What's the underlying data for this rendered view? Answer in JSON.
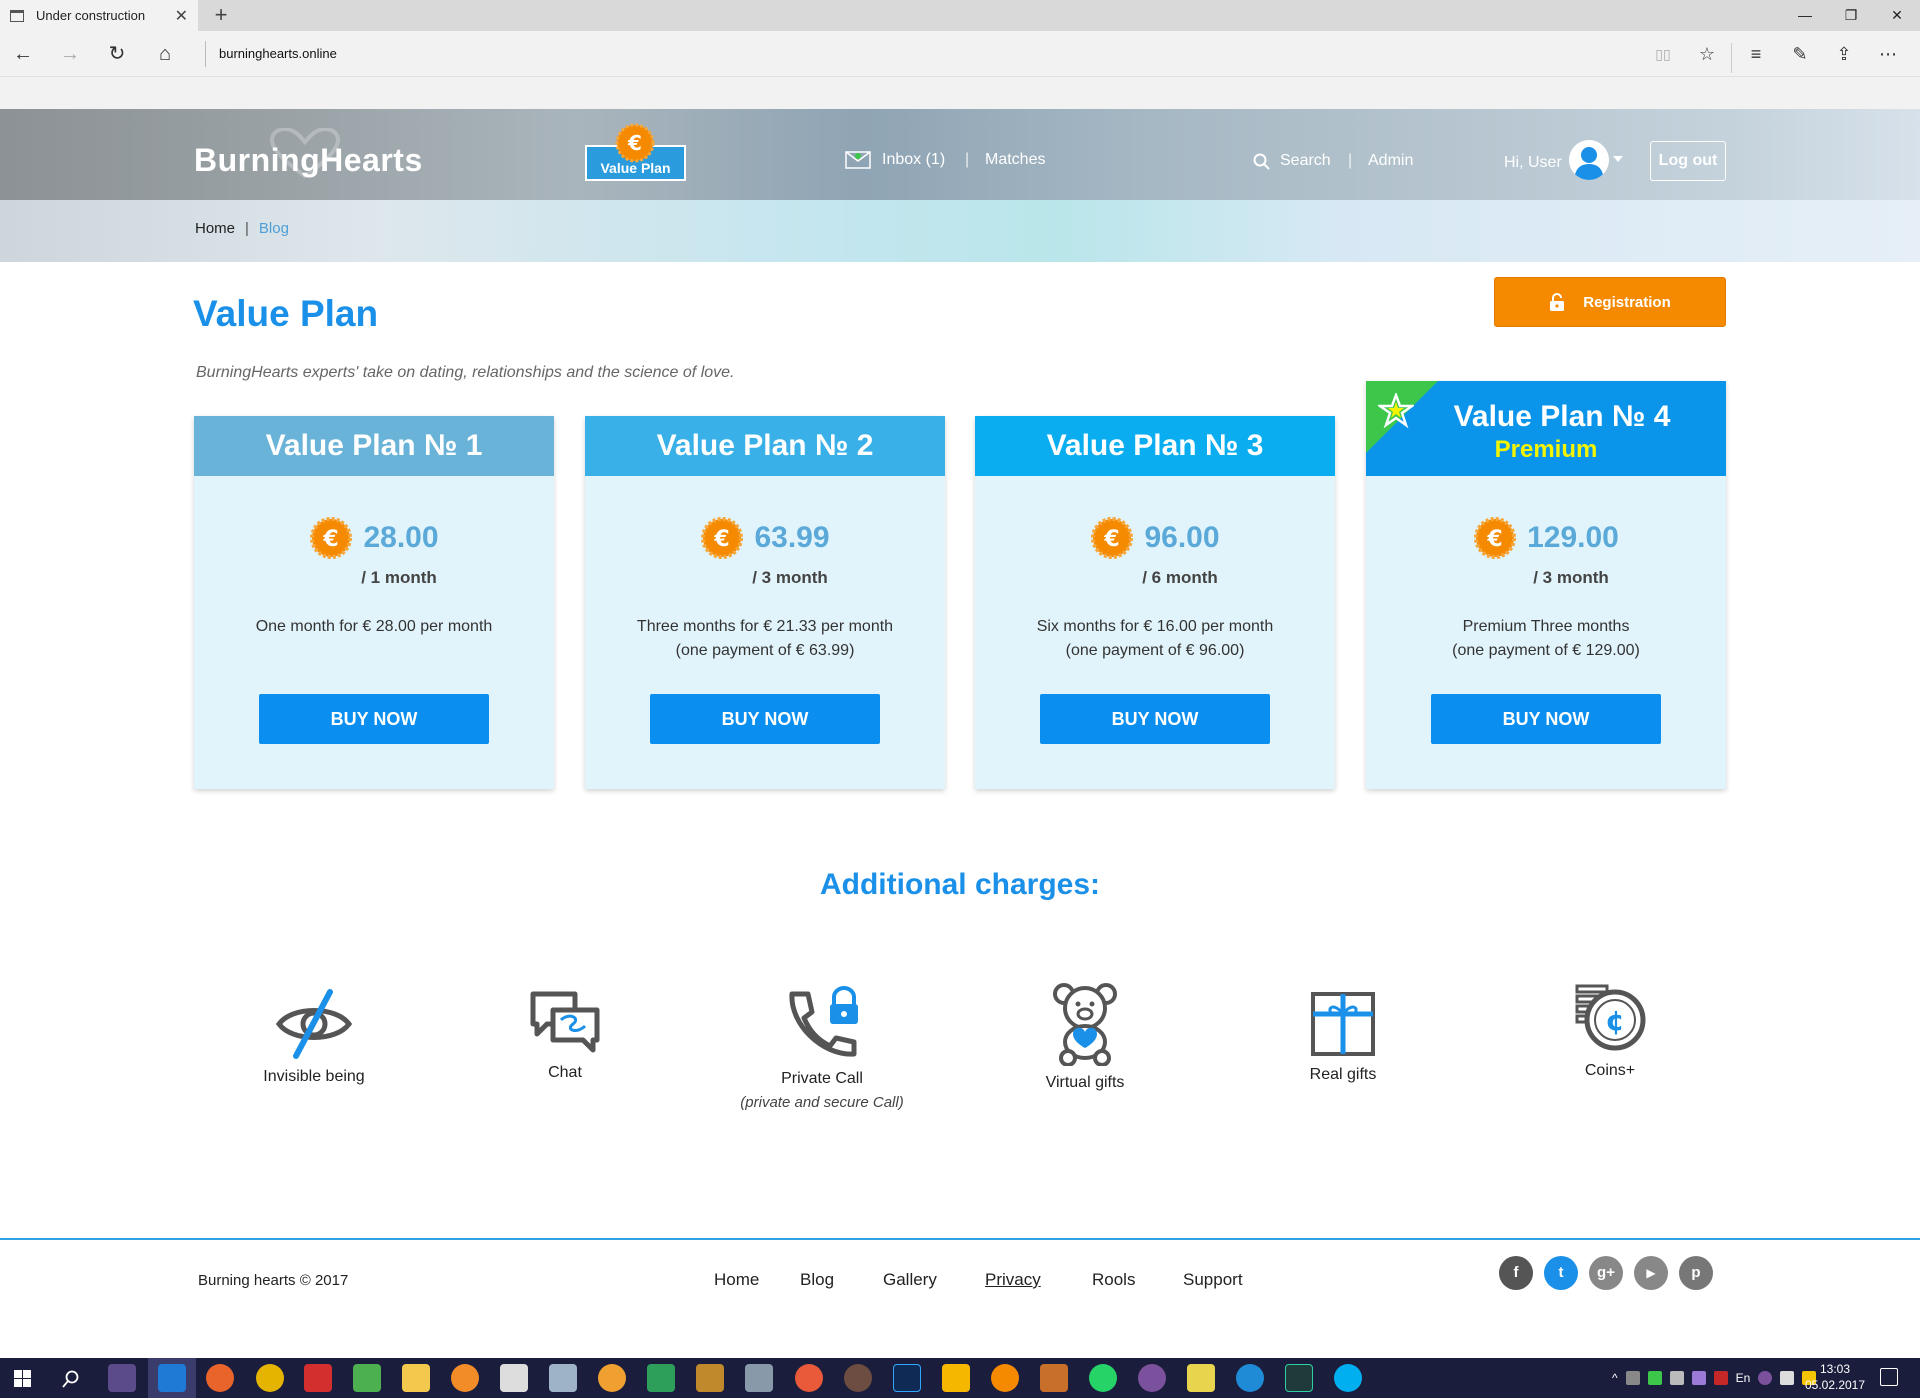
{
  "browser": {
    "tab_title": "Under construction",
    "tab_close": "✕",
    "new_tab": "+",
    "address": "burninghearts.online",
    "back": "←",
    "forward": "→",
    "refresh": "↻",
    "home": "⌂",
    "window_minimize": "—",
    "window_restore": "❐",
    "window_close": "✕",
    "tools": {
      "reading_view": "▯▯",
      "favorite": "☆",
      "hub": "≡",
      "notes": "✎",
      "share": "⇪",
      "more": "⋯"
    }
  },
  "header": {
    "logo": "BurningHearts",
    "value_plan_badge": "Value Plan",
    "inbox": "Inbox (1)",
    "matches": "Matches",
    "search": "Search",
    "admin": "Admin",
    "greeting": "Hi, User",
    "logout": "Log out",
    "separator": "|"
  },
  "breadcrumb": {
    "home": "Home",
    "separator": "|",
    "current": "Blog"
  },
  "main": {
    "title": "Value Plan",
    "subtitle": "BurningHearts experts' take on dating, relationships and the science of love.",
    "registration": "Registration"
  },
  "plans": [
    {
      "name": "Value Plan № 1",
      "price": "28.00",
      "period": "/ 1 month",
      "desc_line1": "One month for  € 28.00 per month",
      "desc_line2": "",
      "button": "BUY NOW",
      "color": "#6ab3d8"
    },
    {
      "name": "Value Plan № 2",
      "price": "63.99",
      "period": "/ 3 month",
      "desc_line1": "Three months for € 21.33 per month",
      "desc_line2": "(one payment of € 63.99)",
      "button": "BUY NOW",
      "color": "#3ab0e8"
    },
    {
      "name": "Value Plan № 3",
      "price": "96.00",
      "period": "/ 6 month",
      "desc_line1": "Six months for  € 16.00 per month",
      "desc_line2": "(one payment of € 96.00)",
      "button": "BUY NOW",
      "color": "#0aaef0"
    },
    {
      "name": "Value Plan № 4",
      "badge": "Premium",
      "price": "129.00",
      "period": "/ 3 month",
      "desc_line1": "Premium Three months",
      "desc_line2": "(one payment of € 129.00)",
      "button": "BUY NOW",
      "color": "#0a94ea"
    }
  ],
  "additional": {
    "title": "Additional charges:",
    "items": [
      {
        "label": "Invisible being",
        "sub": "",
        "icon": "invisible-eye-icon"
      },
      {
        "label": "Chat",
        "sub": "",
        "icon": "chat-icon"
      },
      {
        "label": "Private Call",
        "sub": "(private and secure Call)",
        "icon": "private-call-icon"
      },
      {
        "label": "Virtual gifts",
        "sub": "",
        "icon": "teddy-bear-icon"
      },
      {
        "label": "Real gifts",
        "sub": "",
        "icon": "gift-box-icon"
      },
      {
        "label": "Coins+",
        "sub": "",
        "icon": "coins-icon"
      }
    ]
  },
  "footer": {
    "copyright": "Burning hearts © 2017",
    "nav": {
      "home": "Home",
      "blog": "Blog",
      "gallery": "Gallery",
      "privacy": "Privacy",
      "rools": "Rools",
      "support": "Support"
    },
    "social": {
      "facebook": "f",
      "twitter": "t",
      "googleplus": "g+",
      "youtube": "▶",
      "pinterest": "p"
    }
  },
  "taskbar": {
    "lang": "En",
    "time": "13:03",
    "date": "05.02.2017"
  },
  "colors": {
    "accent": "#1a90e8",
    "button": "#0a8ef0",
    "registration": "#f58a00",
    "card_bg": "#e1f4fb",
    "premium_text": "#f4f400"
  }
}
